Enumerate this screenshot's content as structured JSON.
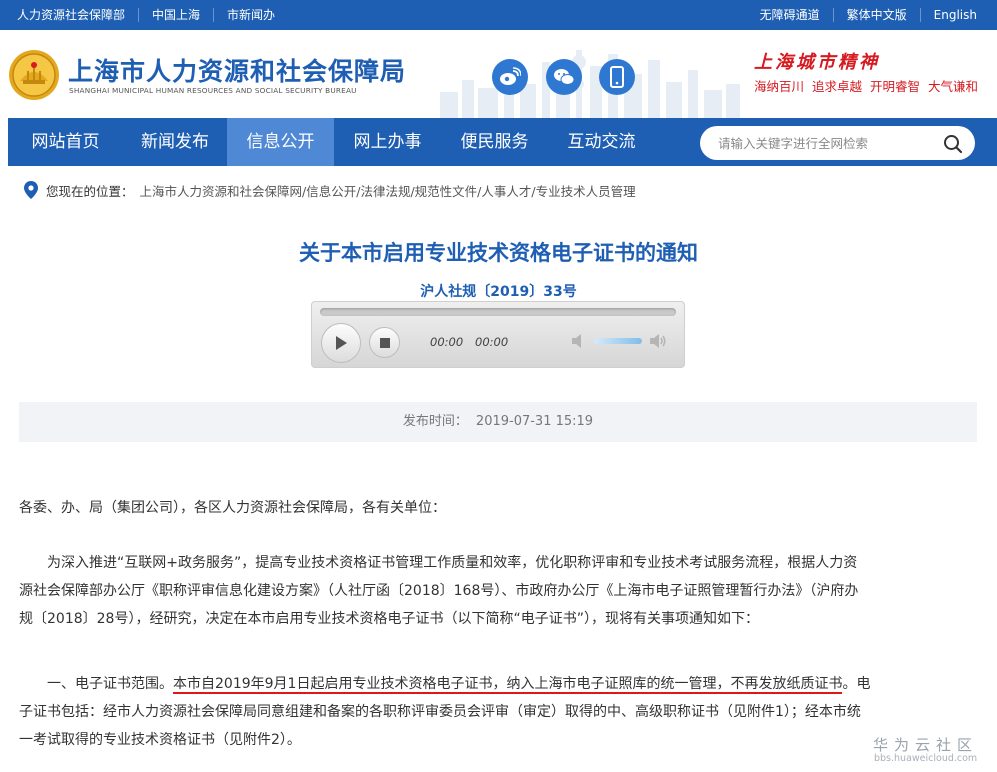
{
  "topbar": {
    "left_links": [
      "人力资源社会保障部",
      "中国上海",
      "市新闻办"
    ],
    "right_links": [
      "无障碍通道",
      "繁体中文版",
      "English"
    ]
  },
  "header": {
    "title_cn": "上海市人力资源和社会保障局",
    "title_en": "SHANGHAI MUNICIPAL HUMAN RESOURCES AND SOCIAL SECURITY BUREAU",
    "social_icons": [
      "weibo-icon",
      "wechat-icon",
      "mobile-icon"
    ],
    "spirit_title": "上海城市精神",
    "spirit_words": [
      "海纳百川",
      "追求卓越",
      "开明睿智",
      "大气谦和"
    ],
    "accent_red": "#d51a20"
  },
  "nav": {
    "items": [
      {
        "label": "网站首页",
        "active": false
      },
      {
        "label": "新闻发布",
        "active": false
      },
      {
        "label": "信息公开",
        "active": true
      },
      {
        "label": "网上办事",
        "active": false
      },
      {
        "label": "便民服务",
        "active": false
      },
      {
        "label": "互动交流",
        "active": false
      }
    ],
    "search_placeholder": "请输入关键字进行全网检索",
    "nav_blue": "#1f5fb3",
    "active_blue": "#4f89d6"
  },
  "breadcrumb": {
    "label": "您现在的位置：",
    "crumbs": [
      "上海市人力资源和社会保障网/",
      "信息公开/",
      "法律法规/",
      "规范性文件/",
      "人事人才/",
      "专业技术人员管理"
    ]
  },
  "article": {
    "title": "关于本市启用专业技术资格电子证书的通知",
    "doc_number": "沪人社规〔2019〕33号",
    "player": {
      "current_time": "00:00",
      "duration": "00:00",
      "volume_level": 0.6
    },
    "publish_label": "发布时间：",
    "publish_time": "2019-07-31 15:19",
    "salutation": "各委、办、局（集团公司），各区人力资源社会保障局，各有关单位：",
    "intro_lines": [
      "为深入推进“互联网+政务服务”，提高专业技术资格证书管理工作质量和效率，优化职称评审和专业技术考试服务流程，根据人力资",
      "源社会保障部办公厅《职称评审信息化建设方案》（人社厅函〔2018〕168号）、市政府办公厅《上海市电子证照管理暂行办法》（沪府办",
      "规〔2018〕28号），经研究，决定在本市启用专业技术资格电子证书（以下简称“电子证书”），现将有关事项通知如下："
    ],
    "section1": {
      "prefix": "一、电子证书范围。",
      "highlight": "本市自2019年9月1日起启用专业技术资格电子证书，纳入上海市电子证照库的统一管理，不再发放纸质证书",
      "suffix": "。电",
      "lines": [
        "子证书包括：经市人力资源社会保障局同意组建和备案的各职称评审委员会评审（审定）取得的中、高级职称证书（见附件1）；经本市统",
        "一考试取得的专业技术资格证书（见附件2）。"
      ]
    }
  },
  "watermark": {
    "cn": "华为云社区",
    "en": "bbs.huaweicloud.com"
  }
}
